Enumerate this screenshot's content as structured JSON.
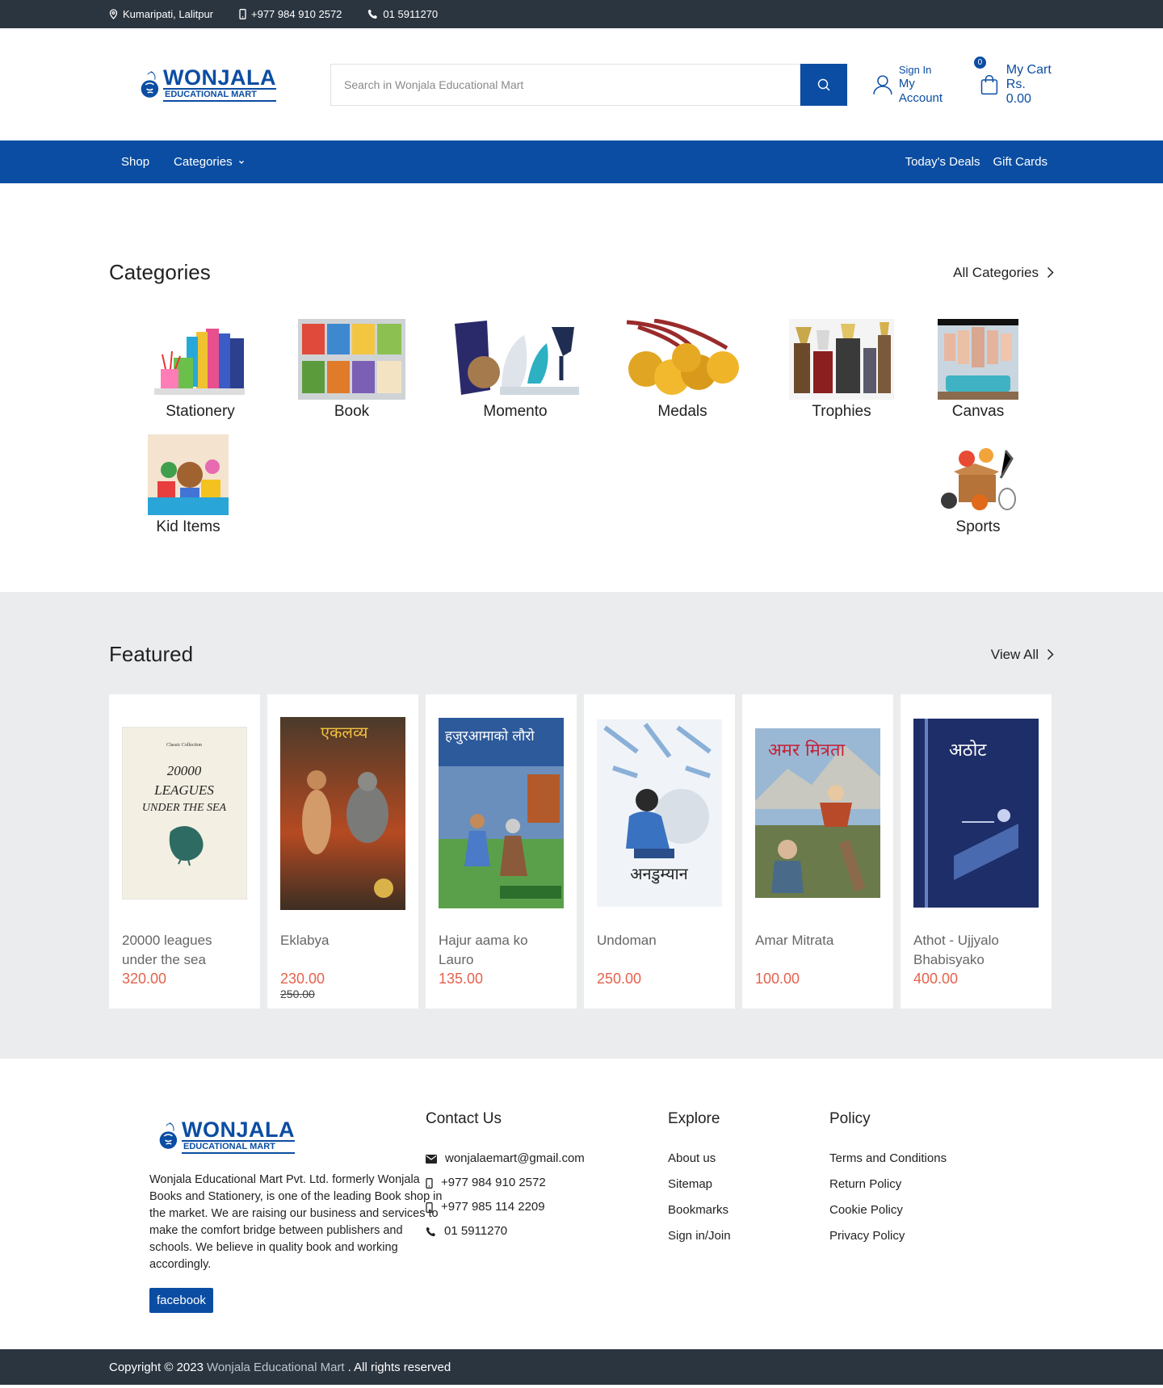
{
  "topbar": {
    "location": "Kumaripati, Lalitpur",
    "mobile": "+977 984 910 2572",
    "phone": "01 5911270"
  },
  "header": {
    "logo_line1": "WONJALA",
    "logo_line2": "EDUCATIONAL MART",
    "search_placeholder": "Search in Wonjala Educational Mart",
    "signin_label": "Sign In",
    "account_label": "My Account",
    "cart_count": "0",
    "cart_label": "My Cart",
    "cart_total": "Rs. 0.00"
  },
  "nav": {
    "shop": "Shop",
    "categories": "Categories",
    "deals": "Today's Deals",
    "gift_cards": "Gift Cards"
  },
  "categories": {
    "title": "Categories",
    "link": "All Categories",
    "items": [
      {
        "label": "Stationery"
      },
      {
        "label": "Book"
      },
      {
        "label": "Momento"
      },
      {
        "label": "Medals"
      },
      {
        "label": "Trophies"
      },
      {
        "label": "Canvas"
      },
      {
        "label": "Kid Items"
      },
      {
        "label": "Sports"
      }
    ]
  },
  "featured": {
    "title": "Featured",
    "link": "View All",
    "products": [
      {
        "name": "20000 leagues under the sea",
        "price": "320.00",
        "old_price": "",
        "cover_title": "20000 LEAGUES UNDER THE SEA",
        "cover_top": "Classic Collection"
      },
      {
        "name": "Eklabya",
        "price": "230.00",
        "old_price": "250.00",
        "cover_title": "एकलव्य"
      },
      {
        "name": "Hajur aama ko Lauro",
        "price": "135.00",
        "old_price": "",
        "cover_title": "हजुरआमाको लौरो"
      },
      {
        "name": "Undoman",
        "price": "250.00",
        "old_price": "",
        "cover_title": "अनडुम्यान"
      },
      {
        "name": "Amar Mitrata",
        "price": "100.00",
        "old_price": "",
        "cover_title": "अमर मित्रता"
      },
      {
        "name": "Athot - Ujjyalo Bhabisyako",
        "price": "400.00",
        "old_price": "",
        "cover_title": "अठोट"
      }
    ]
  },
  "footer": {
    "description": "Wonjala Educational Mart Pvt. Ltd. formerly Wonjala Books and Stationery, is one of the leading Book shop in the market. We are raising our business and services to make the comfort bridge between publishers and schools. We believe in quality book and working accordingly.",
    "facebook": "facebook",
    "contact_title": "Contact Us",
    "email": "wonjalaemart@gmail.com",
    "mobile1": "+977 984 910 2572",
    "mobile2": "+977 985 114 2209",
    "phone": "01 5911270",
    "explore_title": "Explore",
    "explore": [
      "About us",
      "Sitemap",
      "Bookmarks",
      "Sign in/Join"
    ],
    "policy_title": "Policy",
    "policy": [
      "Terms and Conditions",
      "Return Policy",
      "Cookie Policy",
      "Privacy Policy"
    ]
  },
  "copyright": {
    "prefix": "Copyright © 2023",
    "brand": "Wonjala Educational Mart",
    "suffix": ". All rights reserved"
  },
  "colors": {
    "brand": "#0b4da2",
    "dark": "#2b3540",
    "price": "#e5624d",
    "featured_bg": "#ebeced"
  }
}
